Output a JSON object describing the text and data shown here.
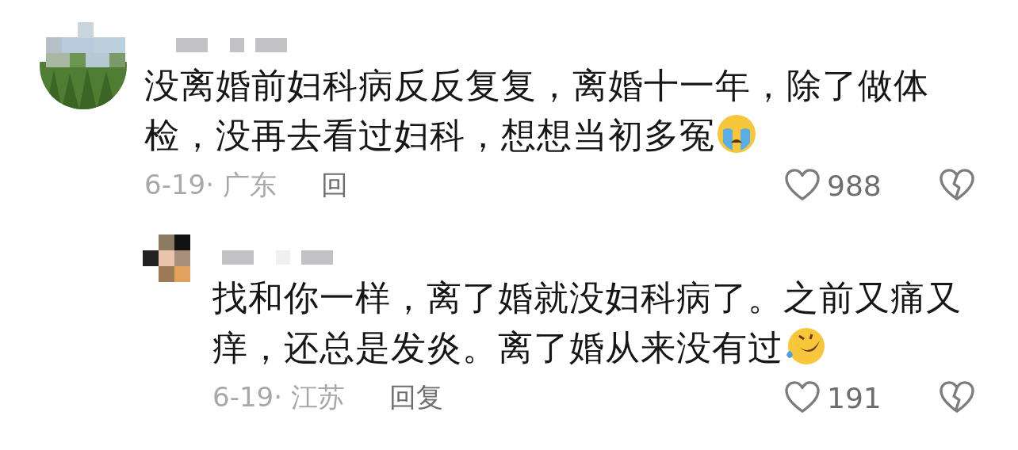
{
  "comments": [
    {
      "kind": "top",
      "text": "没离婚前妇科病反反复复，离婚十一年，除了做体检，没再去看过妇科，想想当初多冤",
      "emoji": {
        "kind": "crying"
      },
      "date_location": "6-19· 广东",
      "reply": "回",
      "likes": "988"
    },
    {
      "kind": "reply",
      "text": "找和你一样，离了婚就没妇科病了。之前又痛又痒，还总是发炎。离了婚从来没有过",
      "emoji": {
        "kind": "laughing"
      },
      "date_location": "6-19· 江苏",
      "reply": "回复",
      "likes": "191"
    }
  ]
}
